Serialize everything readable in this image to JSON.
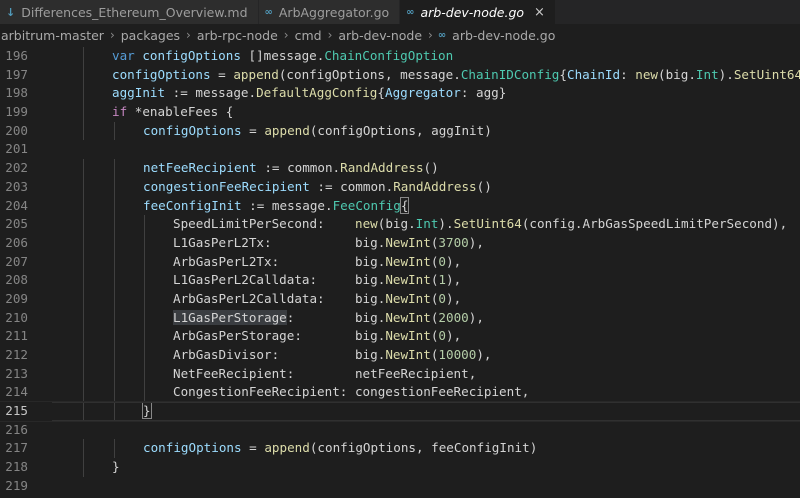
{
  "tabs": [
    {
      "label": "Differences_Ethereum_Overview.md",
      "icon": "markdown-icon",
      "active": false
    },
    {
      "label": "ArbAggregator.go",
      "icon": "go-file-icon",
      "active": false
    },
    {
      "label": "arb-dev-node.go",
      "icon": "go-file-icon",
      "active": true,
      "close": "×"
    }
  ],
  "breadcrumb": [
    "arbitrum-master",
    "packages",
    "arb-rpc-node",
    "cmd",
    "arb-dev-node",
    "arb-dev-node.go"
  ],
  "editor": {
    "current_line": 215,
    "lines": [
      {
        "n": "196",
        "indent": 2,
        "tokens": [
          [
            "kw",
            "var "
          ],
          [
            "v",
            "configOptions"
          ],
          [
            "p",
            " []message."
          ],
          [
            "t",
            "ChainConfigOption"
          ]
        ]
      },
      {
        "n": "197",
        "indent": 2,
        "tokens": [
          [
            "v",
            "configOptions"
          ],
          [
            "p",
            " = "
          ],
          [
            "f",
            "append"
          ],
          [
            "p",
            "(configOptions, message."
          ],
          [
            "t",
            "ChainIDConfig"
          ],
          [
            "p",
            "{"
          ],
          [
            "v",
            "ChainId"
          ],
          [
            "p",
            ": "
          ],
          [
            "f",
            "new"
          ],
          [
            "p",
            "(big."
          ],
          [
            "t",
            "Int"
          ],
          [
            "p",
            ")."
          ],
          [
            "f",
            "SetUint64"
          ]
        ]
      },
      {
        "n": "198",
        "indent": 2,
        "tokens": [
          [
            "v",
            "aggInit"
          ],
          [
            "p",
            " := message."
          ],
          [
            "f",
            "DefaultAggConfig"
          ],
          [
            "p",
            "{"
          ],
          [
            "v",
            "Aggregator"
          ],
          [
            "p",
            ": agg}"
          ]
        ]
      },
      {
        "n": "199",
        "indent": 2,
        "tokens": [
          [
            "kw2",
            "if"
          ],
          [
            "p",
            " *enableFees {"
          ]
        ]
      },
      {
        "n": "200",
        "indent": 3,
        "tokens": [
          [
            "v",
            "configOptions"
          ],
          [
            "p",
            " = "
          ],
          [
            "f",
            "append"
          ],
          [
            "p",
            "(configOptions, aggInit)"
          ]
        ]
      },
      {
        "n": "201",
        "indent": 0,
        "tokens": []
      },
      {
        "n": "202",
        "indent": 3,
        "tokens": [
          [
            "v",
            "netFeeRecipient"
          ],
          [
            "p",
            " := common."
          ],
          [
            "f",
            "RandAddress"
          ],
          [
            "p",
            "()"
          ]
        ]
      },
      {
        "n": "203",
        "indent": 3,
        "tokens": [
          [
            "v",
            "congestionFeeRecipient"
          ],
          [
            "p",
            " := common."
          ],
          [
            "f",
            "RandAddress"
          ],
          [
            "p",
            "()"
          ]
        ]
      },
      {
        "n": "204",
        "indent": 3,
        "tokens": [
          [
            "v",
            "feeConfigInit"
          ],
          [
            "p",
            " := message."
          ],
          [
            "t",
            "FeeConfig"
          ],
          [
            "bm",
            "{"
          ]
        ]
      },
      {
        "n": "205",
        "indent": 4,
        "tokens": [
          [
            "p",
            "SpeedLimitPerSecond:    "
          ],
          [
            "f",
            "new"
          ],
          [
            "p",
            "(big."
          ],
          [
            "t",
            "Int"
          ],
          [
            "p",
            ")."
          ],
          [
            "f",
            "SetUint64"
          ],
          [
            "p",
            "(config.ArbGasSpeedLimitPerSecond),"
          ]
        ]
      },
      {
        "n": "206",
        "indent": 4,
        "tokens": [
          [
            "p",
            "L1GasPerL2Tx:           big."
          ],
          [
            "f",
            "NewInt"
          ],
          [
            "p",
            "("
          ],
          [
            "n",
            "3700"
          ],
          [
            "p",
            "),"
          ]
        ]
      },
      {
        "n": "207",
        "indent": 4,
        "tokens": [
          [
            "p",
            "ArbGasPerL2Tx:          big."
          ],
          [
            "f",
            "NewInt"
          ],
          [
            "p",
            "("
          ],
          [
            "n",
            "0"
          ],
          [
            "p",
            "),"
          ]
        ]
      },
      {
        "n": "208",
        "indent": 4,
        "tokens": [
          [
            "p",
            "L1GasPerL2Calldata:     big."
          ],
          [
            "f",
            "NewInt"
          ],
          [
            "p",
            "("
          ],
          [
            "n",
            "1"
          ],
          [
            "p",
            "),"
          ]
        ]
      },
      {
        "n": "209",
        "indent": 4,
        "tokens": [
          [
            "p",
            "ArbGasPerL2Calldata:    big."
          ],
          [
            "f",
            "NewInt"
          ],
          [
            "p",
            "("
          ],
          [
            "n",
            "0"
          ],
          [
            "p",
            "),"
          ]
        ]
      },
      {
        "n": "210",
        "indent": 4,
        "tokens": [
          [
            "hl",
            "L1GasPerStorage"
          ],
          [
            "p",
            ":        big."
          ],
          [
            "f",
            "NewInt"
          ],
          [
            "p",
            "("
          ],
          [
            "n",
            "2000"
          ],
          [
            "p",
            "),"
          ]
        ]
      },
      {
        "n": "211",
        "indent": 4,
        "tokens": [
          [
            "p",
            "ArbGasPerStorage:       big."
          ],
          [
            "f",
            "NewInt"
          ],
          [
            "p",
            "("
          ],
          [
            "n",
            "0"
          ],
          [
            "p",
            "),"
          ]
        ]
      },
      {
        "n": "212",
        "indent": 4,
        "tokens": [
          [
            "p",
            "ArbGasDivisor:          big."
          ],
          [
            "f",
            "NewInt"
          ],
          [
            "p",
            "("
          ],
          [
            "n",
            "10000"
          ],
          [
            "p",
            "),"
          ]
        ]
      },
      {
        "n": "213",
        "indent": 4,
        "tokens": [
          [
            "p",
            "NetFeeRecipient:        netFeeRecipient,"
          ]
        ]
      },
      {
        "n": "214",
        "indent": 4,
        "tokens": [
          [
            "p",
            "CongestionFeeRecipient: congestionFeeRecipient,"
          ]
        ]
      },
      {
        "n": "215",
        "indent": 3,
        "tokens": [
          [
            "bm",
            "}"
          ]
        ]
      },
      {
        "n": "216",
        "indent": 0,
        "tokens": []
      },
      {
        "n": "217",
        "indent": 3,
        "tokens": [
          [
            "v",
            "configOptions"
          ],
          [
            "p",
            " = "
          ],
          [
            "f",
            "append"
          ],
          [
            "p",
            "(configOptions, feeConfigInit)"
          ]
        ]
      },
      {
        "n": "218",
        "indent": 2,
        "tokens": [
          [
            "p",
            "}"
          ]
        ]
      },
      {
        "n": "219",
        "indent": 0,
        "tokens": []
      }
    ]
  }
}
